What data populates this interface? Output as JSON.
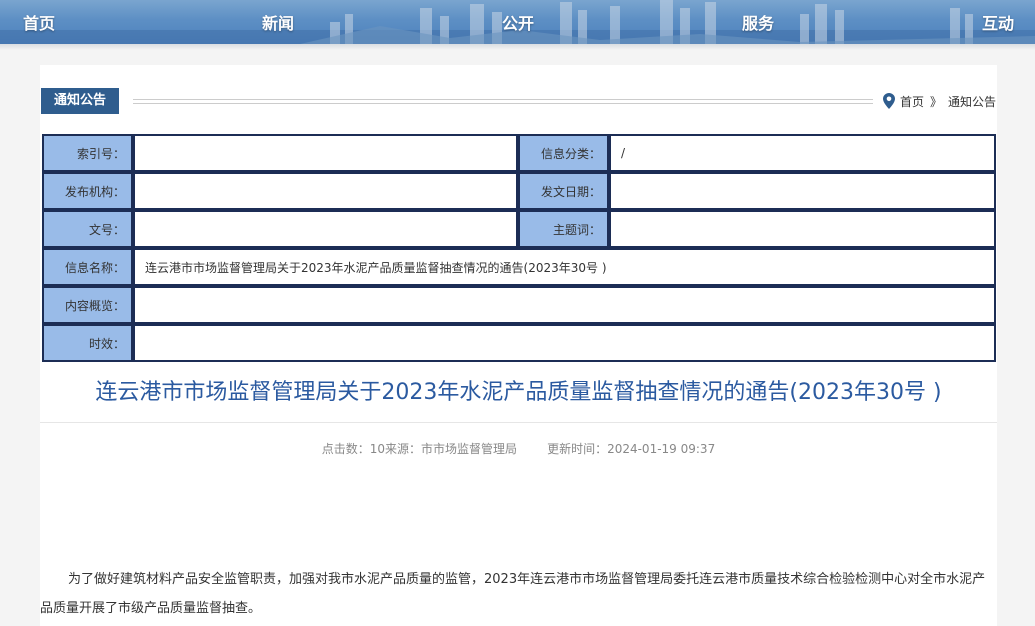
{
  "nav": {
    "items": [
      "首页",
      "新闻",
      "公开",
      "服务",
      "互动"
    ]
  },
  "section": {
    "tag": "通知公告",
    "breadcrumb": [
      "首页",
      "》",
      "通知公告"
    ]
  },
  "info_table": {
    "suoyin_label": "索引号：",
    "suoyin_value": "",
    "fenlei_label": "信息分类：",
    "fenlei_value": "/",
    "jigou_label": "发布机构：",
    "jigou_value": "",
    "riqi_label": "发文日期：",
    "riqi_value": "",
    "wenhao_label": "文号：",
    "wenhao_value": "",
    "zhuti_label": "主题词：",
    "zhuti_value": "",
    "mingcheng_label": "信息名称：",
    "mingcheng_value": "连云港市市场监督管理局关于2023年水泥产品质量监督抽查情况的通告(2023年30号 )",
    "gailan_label": "内容概览：",
    "gailan_value": "",
    "shixiao_label": "时效：",
    "shixiao_value": ""
  },
  "article": {
    "title": "连云港市市场监督管理局关于2023年水泥产品质量监督抽查情况的通告(2023年30号 )",
    "meta_clicks": "点击数：10来源：市市场监督管理局",
    "meta_updated": "更新时间：2024-01-19 09:37",
    "paragraph": "为了做好建筑材料产品安全监管职责，加强对我市水泥产品质量的监管，2023年连云港市市场监督管理局委托连云港市质量技术综合检验检测中心对全市水泥产品质量开展了市级产品质量监督抽查。"
  },
  "colors": {
    "nav_bg": "#5d8fc4",
    "section_tag": "#2f5d8e",
    "label_bg": "#99bbe8",
    "border": "#1c2d55",
    "title": "#2b5aa0"
  }
}
